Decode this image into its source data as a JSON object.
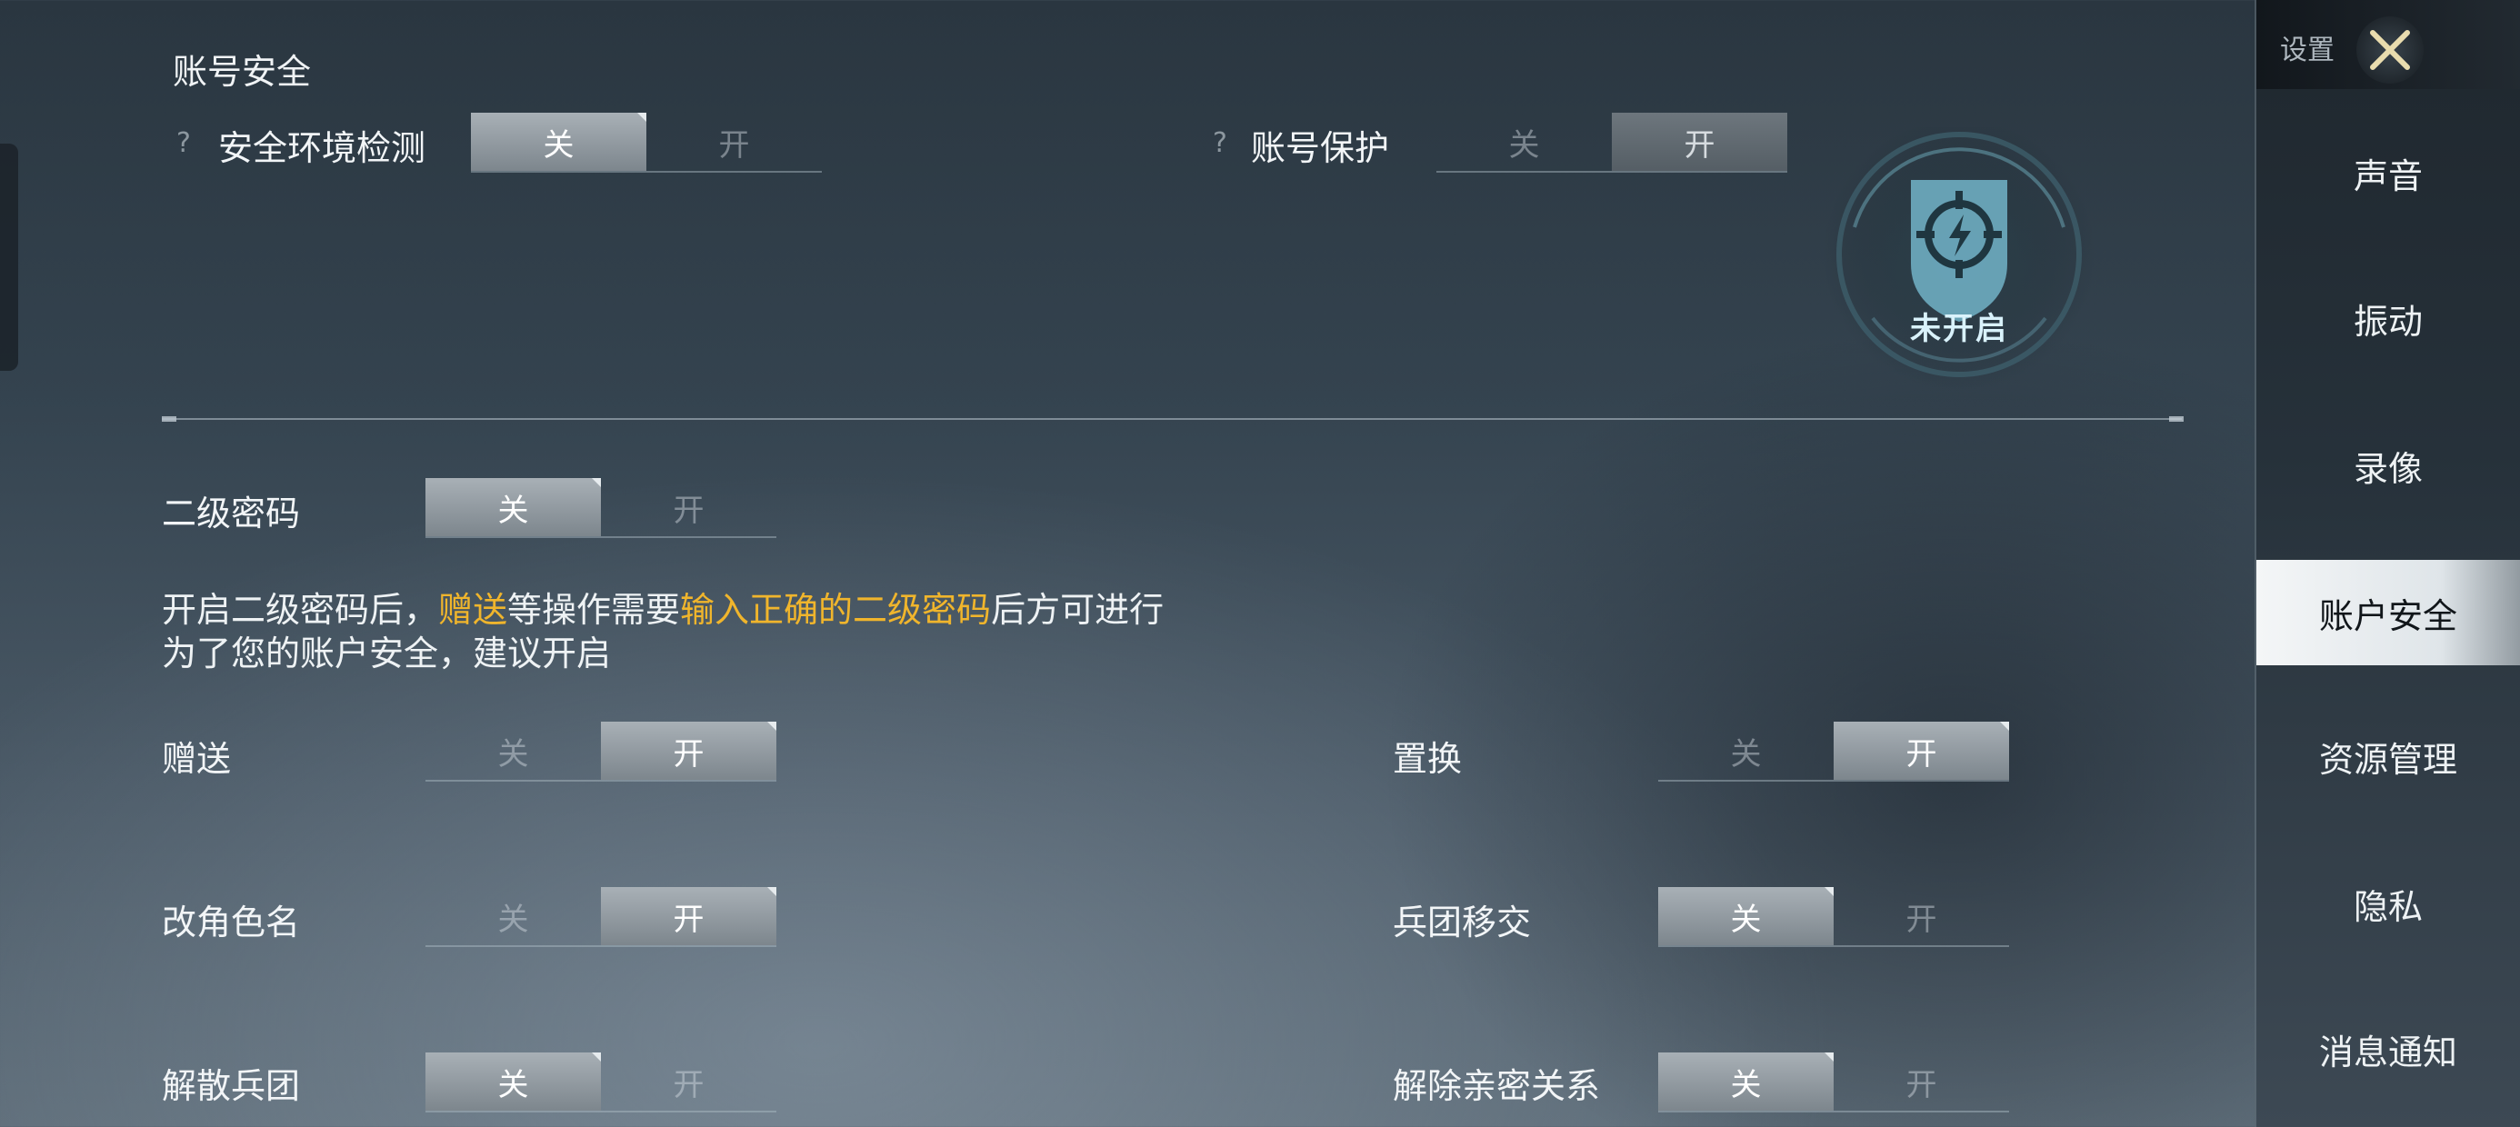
{
  "account_security": {
    "title": "账号安全",
    "env_check": {
      "help": "?",
      "label": "安全环境检测",
      "off": "关",
      "on": "开",
      "value": "off"
    },
    "account_protect": {
      "help": "?",
      "label": "账号保护",
      "off": "关",
      "on": "开",
      "value": "on"
    },
    "badge_status": "未开启"
  },
  "secondary_password": {
    "label": "二级密码",
    "off": "关",
    "on": "开",
    "value": "off",
    "desc_line1": {
      "part1": "开启二级密码后，",
      "highlight1": "赠送",
      "part2": "等操作需要",
      "highlight2": "输入正确的二级密码",
      "part3": "后方可进行"
    },
    "desc_line2": "为了您的账户安全，建议开启",
    "highlight_color": "#f0b52c"
  },
  "options": {
    "gift": {
      "label": "赠送",
      "off": "关",
      "on": "开",
      "value": "on"
    },
    "exchange": {
      "label": "置换",
      "off": "关",
      "on": "开",
      "value": "on"
    },
    "rename": {
      "label": "改角色名",
      "off": "关",
      "on": "开",
      "value": "on"
    },
    "legion_transfer": {
      "label": "兵团移交",
      "off": "关",
      "on": "开",
      "value": "off"
    },
    "disband_legion": {
      "label": "解散兵团",
      "off": "关",
      "on": "开",
      "value": "off"
    },
    "remove_intimacy": {
      "label": "解除亲密关系",
      "off": "关",
      "on": "开",
      "value": "off"
    }
  },
  "sidebar": {
    "title": "设置",
    "close_icon": "close-icon",
    "items": [
      {
        "label": "声音"
      },
      {
        "label": "振动"
      },
      {
        "label": "录像"
      },
      {
        "label": "账户安全",
        "active": true
      },
      {
        "label": "资源管理"
      },
      {
        "label": "隐私"
      },
      {
        "label": "消息通知"
      }
    ]
  }
}
